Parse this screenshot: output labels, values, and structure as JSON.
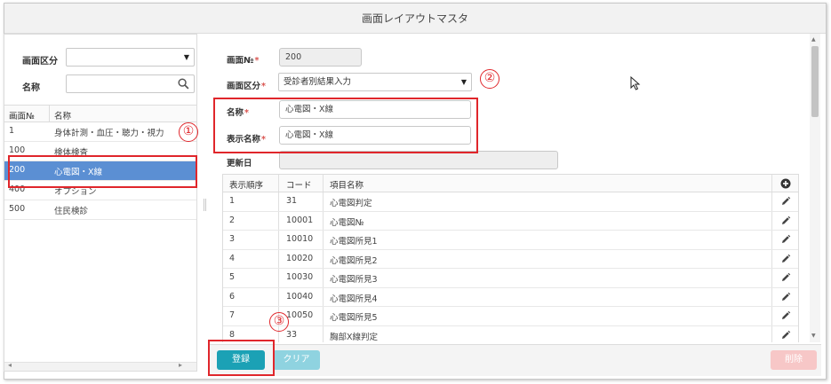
{
  "window": {
    "title": "画面レイアウトマスタ"
  },
  "left_panel": {
    "category_label": "画面区分",
    "category_value": "",
    "name_label": "名称",
    "name_value": "",
    "table": {
      "headers": [
        "画面№",
        "名称"
      ],
      "rows": [
        {
          "id": "1",
          "name": "身体計測・血圧・聴力・視力",
          "selected": false
        },
        {
          "id": "100",
          "name": "検体検査",
          "selected": false
        },
        {
          "id": "200",
          "name": "心電図・X線",
          "selected": true
        },
        {
          "id": "400",
          "name": "オプション",
          "selected": false
        },
        {
          "id": "500",
          "name": "住民検診",
          "selected": false
        }
      ]
    }
  },
  "form": {
    "screen_no_label": "画面№",
    "screen_no_value": "200",
    "category_label": "画面区分",
    "category_value": "受診者別結果入力",
    "name_label": "名称",
    "name_value": "心電図・X線",
    "display_name_label": "表示名称",
    "display_name_value": "心電図・X線",
    "updated_label": "更新日",
    "updated_value": "",
    "required_mark": "*"
  },
  "items_table": {
    "headers": [
      "表示順序",
      "コード",
      "項目名称"
    ],
    "rows": [
      {
        "order": "1",
        "code": "31",
        "name": "心電図判定"
      },
      {
        "order": "2",
        "code": "10001",
        "name": "心電図№"
      },
      {
        "order": "3",
        "code": "10010",
        "name": "心電図所見1"
      },
      {
        "order": "4",
        "code": "10020",
        "name": "心電図所見2"
      },
      {
        "order": "5",
        "code": "10030",
        "name": "心電図所見3"
      },
      {
        "order": "6",
        "code": "10040",
        "name": "心電図所見4"
      },
      {
        "order": "7",
        "code": "10050",
        "name": "心電図所見5"
      },
      {
        "order": "8",
        "code": "33",
        "name": "胸部X線判定"
      }
    ]
  },
  "buttons": {
    "register": "登録",
    "clear": "クリア",
    "delete": "削除"
  },
  "annotations": {
    "one": "①",
    "two": "②",
    "three": "③"
  },
  "colors": {
    "selected_row": "#5b8fd3",
    "register": "#1ba1b5",
    "clear": "#8fd3e0",
    "delete": "#f7c7c7",
    "annotation": "#e0262b"
  }
}
